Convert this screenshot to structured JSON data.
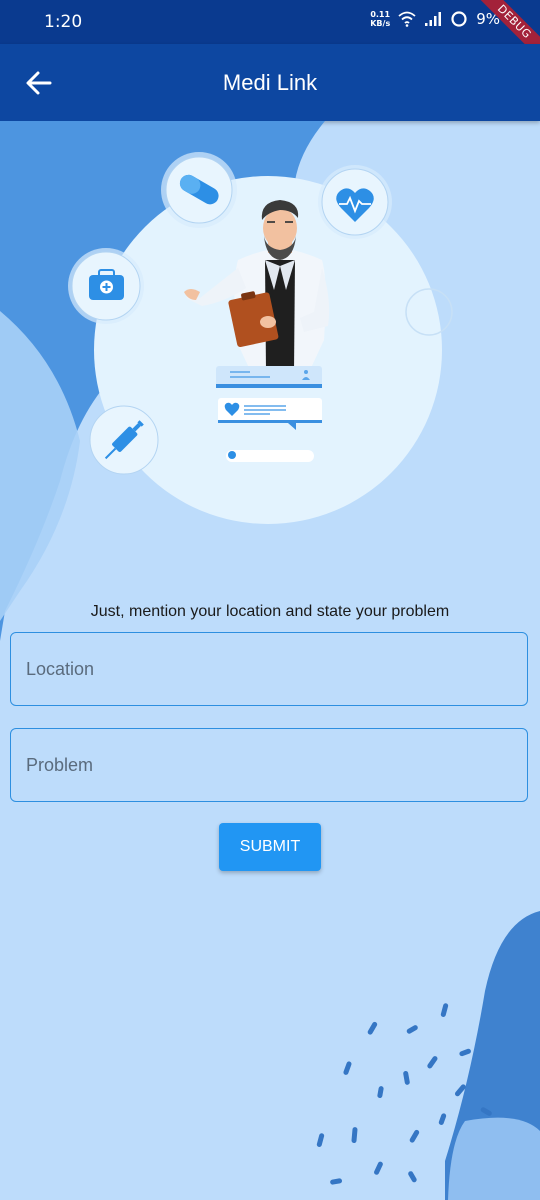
{
  "status_bar": {
    "time": "1:20",
    "net_speed_value": "0.11",
    "net_speed_unit": "KB/s",
    "battery": "9%",
    "debug_label": "DEBUG"
  },
  "app_bar": {
    "title": "Medi Link",
    "back_icon": "arrow-left-icon",
    "color": "#0d47a1"
  },
  "form": {
    "instruction": "Just, mention your location and state your problem",
    "location_placeholder": "Location",
    "location_value": "",
    "problem_placeholder": "Problem",
    "problem_value": "",
    "submit_label": "SUBMIT",
    "accent_color": "#2196f3"
  },
  "illustration": {
    "icons": [
      "pill-icon",
      "heartbeat-icon",
      "medical-kit-icon",
      "syringe-icon"
    ]
  }
}
